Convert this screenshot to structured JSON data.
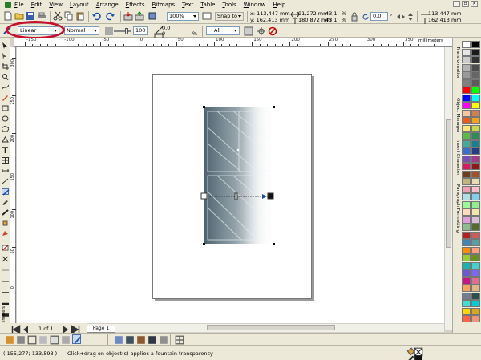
{
  "menu": [
    "File",
    "Edit",
    "View",
    "Layout",
    "Arrange",
    "Effects",
    "Bitmaps",
    "Text",
    "Table",
    "Tools",
    "Window",
    "Help"
  ],
  "standard_toolbar": {
    "zoom": "100%",
    "snap_to": "Snap to",
    "x": "x: 113,447 mm",
    "y": "y: 162,413 mm",
    "w": "91,272 mm",
    "h": "180,872 mm",
    "scale_x": "43,1",
    "scale_y": "43,1",
    "pct": "%",
    "rotation": "0,0",
    "rotation_unit": "°",
    "pos2_x": "113,447 mm",
    "pos2_y": "162,413 mm"
  },
  "property_bar": {
    "transparency_type": "Linear",
    "merge_mode": "Normal",
    "slider_value": "100",
    "angle": "0,0",
    "edge_pad": "0",
    "pct": "%",
    "apply_to": "All"
  },
  "ruler": {
    "unit": "millimeters",
    "h_labels": [
      "-150",
      "-100",
      "-50",
      "0",
      "50",
      "100",
      "150",
      "200",
      "250",
      "300",
      "350"
    ],
    "v_labels": [
      "300",
      "250",
      "200",
      "150",
      "100",
      "50",
      "0"
    ],
    "v_unit": "millimeters"
  },
  "dockers": [
    "Transformation",
    "Object Manager",
    "Insert Character",
    "Paragraph Formatting"
  ],
  "page_nav": {
    "counter": "1 of 1",
    "tab": "Page 1"
  },
  "status": {
    "coords": "( 155,277; 133,593 )",
    "message": "Click+drag on object(s) applies a fountain transparency"
  },
  "colors": {
    "highlight": "#c8102e",
    "ui_bg": "#ece9d8",
    "canvas_bg": "#ffffff"
  }
}
